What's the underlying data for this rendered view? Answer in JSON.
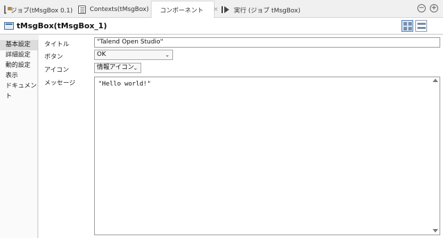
{
  "tabs": [
    {
      "label": "ジョブ(tMsgBox 0.1)",
      "icon": "job-icon"
    },
    {
      "label": "Contexts(tMsgBox)",
      "icon": "contexts-icon"
    },
    {
      "label": "コンポーネント",
      "icon": "component-icon",
      "active": true,
      "close": "×"
    },
    {
      "label": "実行 (ジョブ tMsgBox)",
      "icon": "run-icon"
    }
  ],
  "window_controls": {
    "minimize": "−",
    "maximize": "+"
  },
  "header": {
    "title": "tMsgBox(tMsgBox_1)"
  },
  "sidebar": {
    "items": [
      {
        "label": "基本設定",
        "active": true
      },
      {
        "label": "詳細設定"
      },
      {
        "label": "動的設定"
      },
      {
        "label": "表示"
      },
      {
        "label": "ドキュメント"
      }
    ]
  },
  "form": {
    "title_label": "タイトル",
    "title_value": "\"Talend Open Studio\"",
    "button_label": "ボタン",
    "button_value": "OK",
    "icon_label": "アイコン",
    "icon_value": "情報アイコン",
    "message_label": "メッセージ",
    "message_value": "\"Hello world!\""
  },
  "colors": {
    "active_tab": "#ffffff",
    "background": "#f0f0f0",
    "selected_view": "#d5e5f7"
  }
}
